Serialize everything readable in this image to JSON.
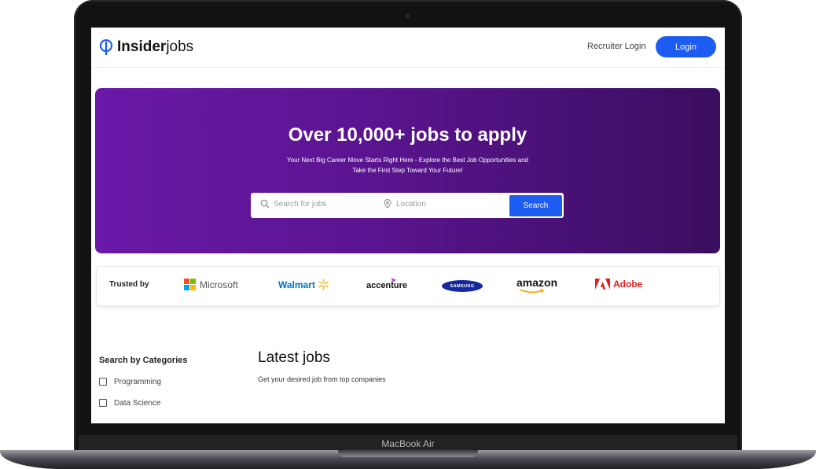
{
  "device": {
    "label": "MacBook Air"
  },
  "header": {
    "logo_bold": "Insider",
    "logo_light": "jobs",
    "recruiter_login": "Recruiter Login",
    "login_button": "Login"
  },
  "hero": {
    "title": "Over 10,000+ jobs to apply",
    "subtitle_line1": "Your Next Big Career Move Starts Right Here - Explore the Best Job Opportunities and",
    "subtitle_line2": "Take the First Step Toward Your Future!",
    "search_placeholder": "Search for jobs",
    "location_placeholder": "Location",
    "search_button": "Search"
  },
  "trusted": {
    "label": "Trusted by",
    "brands": {
      "microsoft": "Microsoft",
      "walmart": "Walmart",
      "accenture": "accenture",
      "samsung": "SAMSUNG",
      "amazon": "amazon",
      "adobe": "Adobe"
    }
  },
  "categories": {
    "heading": "Search by Categories",
    "items": [
      "Programming",
      "Data Science"
    ]
  },
  "latest": {
    "title": "Latest jobs",
    "subtitle": "Get your desired job from top companies"
  },
  "colors": {
    "primary": "#1d5cf0",
    "hero_start": "#6a19a8",
    "hero_end": "#3a0e5f",
    "walmart": "#0071ce",
    "walmart_spark": "#ffc220",
    "adobe": "#e11d1d",
    "samsung": "#1428a0",
    "accenture_accent": "#a100ff",
    "amazon_smile": "#ff9900"
  },
  "icons": [
    "info-pin-logo-icon",
    "search-icon",
    "location-pin-icon",
    "microsoft-logo-icon",
    "walmart-spark-icon",
    "amazon-smile-icon",
    "adobe-logo-icon",
    "checkbox-icon"
  ]
}
